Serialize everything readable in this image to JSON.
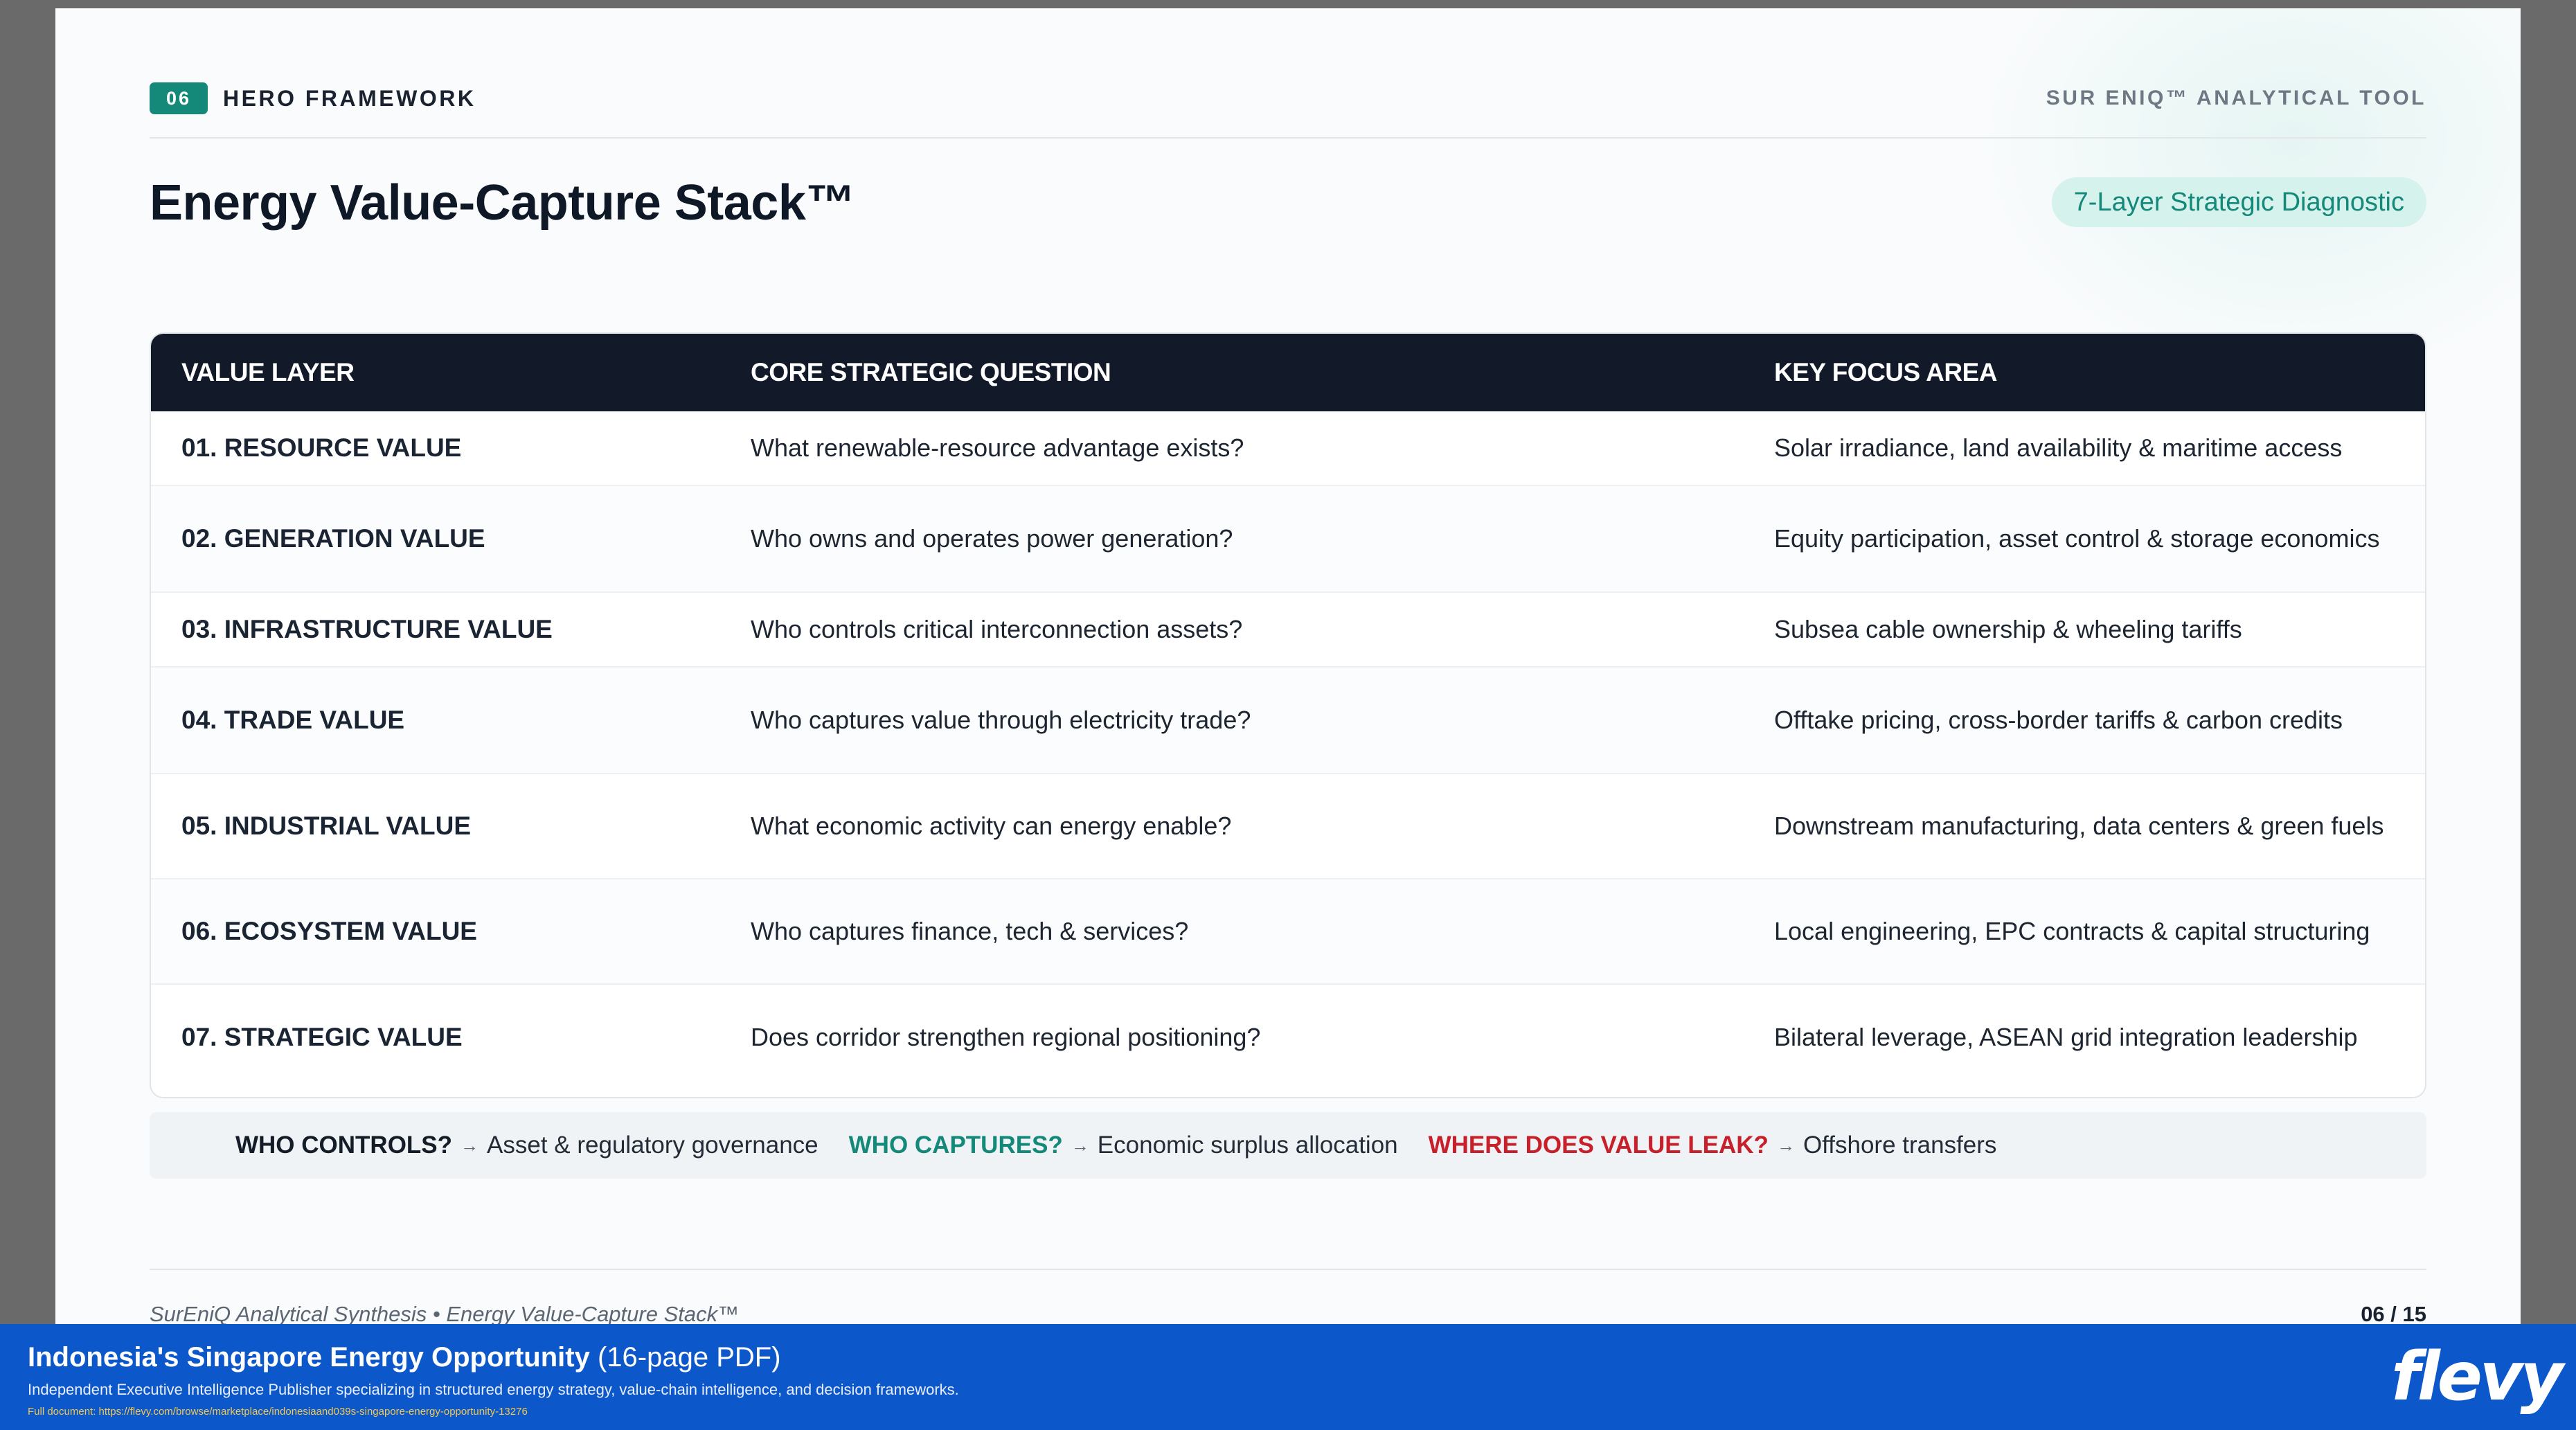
{
  "header": {
    "section_number": "06",
    "section_label": "HERO FRAMEWORK",
    "tool_label": "SUR ENIQ™ ANALYTICAL TOOL"
  },
  "title": "Energy Value-Capture Stack™",
  "title_pill": "7-Layer Strategic Diagnostic",
  "table": {
    "columns": [
      "VALUE LAYER",
      "CORE STRATEGIC QUESTION",
      "KEY FOCUS AREA"
    ],
    "rows": [
      {
        "layer": "01. RESOURCE VALUE",
        "question": "What renewable-resource advantage exists?",
        "focus": "Solar irradiance, land availability & maritime access"
      },
      {
        "layer": "02. GENERATION VALUE",
        "question": "Who owns and operates power generation?",
        "focus": "Equity participation, asset control & storage economics"
      },
      {
        "layer": "03. INFRASTRUCTURE VALUE",
        "question": "Who controls critical interconnection assets?",
        "focus": "Subsea cable ownership & wheeling tariffs"
      },
      {
        "layer": "04. TRADE VALUE",
        "question": "Who captures value through electricity trade?",
        "focus": "Offtake pricing, cross-border tariffs & carbon credits"
      },
      {
        "layer": "05. INDUSTRIAL VALUE",
        "question": "What economic activity can energy enable?",
        "focus": "Downstream manufacturing, data centers & green fuels"
      },
      {
        "layer": "06. ECOSYSTEM VALUE",
        "question": "Who captures finance, tech & services?",
        "focus": "Local engineering, EPC contracts & capital structuring"
      },
      {
        "layer": "07. STRATEGIC VALUE",
        "question": "Does corridor strengthen regional positioning?",
        "focus": "Bilateral leverage, ASEAN grid integration leadership"
      }
    ]
  },
  "legend": [
    {
      "key": "WHO CONTROLS?",
      "arrow": "→",
      "text": "Asset & regulatory governance"
    },
    {
      "key": "WHO CAPTURES?",
      "arrow": "→",
      "text": "Economic surplus allocation"
    },
    {
      "key": "WHERE DOES VALUE LEAK?",
      "arrow": "→",
      "text": "Offshore transfers"
    }
  ],
  "footer": {
    "left": "SurEniQ Analytical Synthesis • Energy Value-Capture Stack™",
    "page": "06 / 15"
  },
  "banner": {
    "title": "Indonesia's Singapore Energy Opportunity",
    "title_sub": "(16-page PDF)",
    "description": "Independent Executive Intelligence Publisher specializing in structured energy strategy, value-chain intelligence, and decision frameworks.",
    "link": "Full document: https://flevy.com/browse/marketplace/indonesiaand039s-singapore-energy-opportunity-13276",
    "brand": "flevy"
  },
  "colors": {
    "accent_teal": "#14897a",
    "header_dark": "#121a2a",
    "leak_red": "#c8202a",
    "banner_blue": "#0c57c9"
  }
}
